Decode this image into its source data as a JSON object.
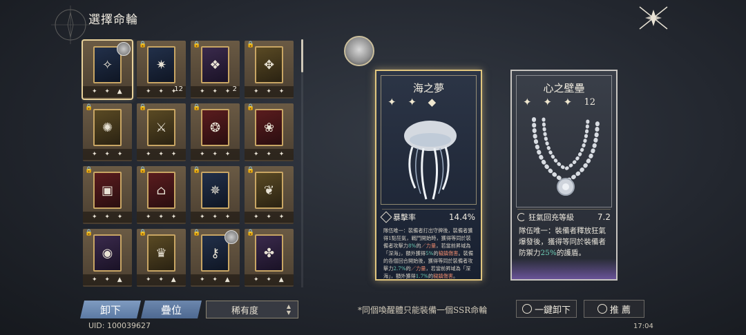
{
  "header": {
    "title": "選擇命輪"
  },
  "grid": {
    "cards": [
      {
        "icon": "jellyfish-icon",
        "stars": "✦ ✦ ▲",
        "count": "",
        "locked": false,
        "badge": true,
        "selected": true,
        "tone": "navy",
        "glyph": "✧"
      },
      {
        "icon": "mask-icon",
        "stars": "✦ ✦ ✦",
        "count": "12",
        "locked": true,
        "badge": false,
        "selected": false,
        "tone": "navy",
        "glyph": "✷"
      },
      {
        "icon": "gate-icon",
        "stars": "✦ ✦ ✦",
        "count": "2",
        "locked": true,
        "badge": false,
        "selected": false,
        "tone": "purple",
        "glyph": "❖"
      },
      {
        "icon": "whale-icon",
        "stars": "✦ ✦ ✦",
        "count": "",
        "locked": true,
        "badge": false,
        "selected": false,
        "tone": "gold",
        "glyph": "✥"
      },
      {
        "icon": "phoenix-icon",
        "stars": "✦ ✦ ✦",
        "count": "",
        "locked": true,
        "badge": false,
        "selected": false,
        "tone": "gold",
        "glyph": "✺"
      },
      {
        "icon": "swords-icon",
        "stars": "✦ ✦ ✦",
        "count": "",
        "locked": true,
        "badge": false,
        "selected": false,
        "tone": "gold",
        "glyph": "⚔"
      },
      {
        "icon": "heart-icon",
        "stars": "✦ ✦ ✦",
        "count": "",
        "locked": true,
        "badge": false,
        "selected": false,
        "tone": "red",
        "glyph": "❂"
      },
      {
        "icon": "rose-icon",
        "stars": "✦ ✦ ✦",
        "count": "",
        "locked": true,
        "badge": false,
        "selected": false,
        "tone": "red",
        "glyph": "❀"
      },
      {
        "icon": "lantern-icon",
        "stars": "✦ ✦ ✦",
        "count": "",
        "locked": true,
        "badge": false,
        "selected": false,
        "tone": "red",
        "glyph": "▣"
      },
      {
        "icon": "window-icon",
        "stars": "✦ ✦ ✦",
        "count": "",
        "locked": true,
        "badge": false,
        "selected": false,
        "tone": "red",
        "glyph": "⌂"
      },
      {
        "icon": "compass-icon",
        "stars": "✦ ✦ ✦",
        "count": "",
        "locked": true,
        "badge": false,
        "selected": false,
        "tone": "navy",
        "glyph": "✵"
      },
      {
        "icon": "lily-icon",
        "stars": "✦ ✦ ✦",
        "count": "",
        "locked": true,
        "badge": false,
        "selected": false,
        "tone": "gold",
        "glyph": "❦"
      },
      {
        "icon": "eye-icon",
        "stars": "✦ ✦ ▲",
        "count": "",
        "locked": true,
        "badge": false,
        "selected": false,
        "tone": "purple",
        "glyph": "◉"
      },
      {
        "icon": "tophat-icon",
        "stars": "✦ ✦ ▲",
        "count": "",
        "locked": true,
        "badge": false,
        "selected": false,
        "tone": "gold",
        "glyph": "♛"
      },
      {
        "icon": "key-icon",
        "stars": "✦ ✦ ▲",
        "count": "",
        "locked": true,
        "badge": true,
        "selected": false,
        "tone": "navy",
        "glyph": "⚷"
      },
      {
        "icon": "rat-icon",
        "stars": "✦ ✦ ▲",
        "count": "",
        "locked": true,
        "badge": false,
        "selected": false,
        "tone": "purple",
        "glyph": "✤"
      }
    ]
  },
  "buttons": {
    "unequip": "卸下",
    "stack": "疊位",
    "sort": "稀有度"
  },
  "uid": "UID: 100039627",
  "left_panel": {
    "name": "海之夢",
    "stars": "✦ ✦ ◆",
    "stat_name": "暴擊率",
    "stat_value": "14.4%",
    "desc_1": "隊伍唯一：裝備者打出守牌後，裝備者獲得1點狂氣，戰鬥開始時，獲得等同於裝備者攻擊力",
    "desc_hl_1": "8%",
    "desc_2": "的",
    "desc_hl_2": "／力量",
    "desc_3": "，若當前昇域為「深海」，額外獲得",
    "desc_hl_3": "5%",
    "desc_4": "的",
    "desc_hl_4": "穢鎮傷害",
    "desc_5": "。裝備的各個回合開始後，獲得等同於裝備者攻擊力",
    "desc_hl_5": "2.7%",
    "desc_6": "的",
    "desc_hl_6": "／力量",
    "desc_7": "，若當前昇域為「深海」，額外獲得",
    "desc_hl_7": "1.7%",
    "desc_8": "的",
    "desc_hl_8": "穢鎮傷害",
    "desc_9": "。"
  },
  "right_panel": {
    "name": "心之壁壘",
    "stars": "✦ ✦ ✦",
    "level": "12",
    "stat_name": "狂氣回充等級",
    "stat_value": "7.2",
    "desc_1": "隊伍唯一：裝備者釋放狂氣爆發後，獲得等同於裝備者防禦力",
    "desc_hl": "25%",
    "desc_2": "的護盾。"
  },
  "note": "*同個喚醒體只能裝備一個SSR命輪",
  "actions": {
    "one_click": "一鍵卸下",
    "recommend": "推 薦"
  },
  "time": "17:04",
  "colors": {
    "accent_gold": "#e1c67e",
    "button_blue": "#6c87ad",
    "highlight_green": "#6fd0b8",
    "highlight_red": "#e98a6e"
  }
}
